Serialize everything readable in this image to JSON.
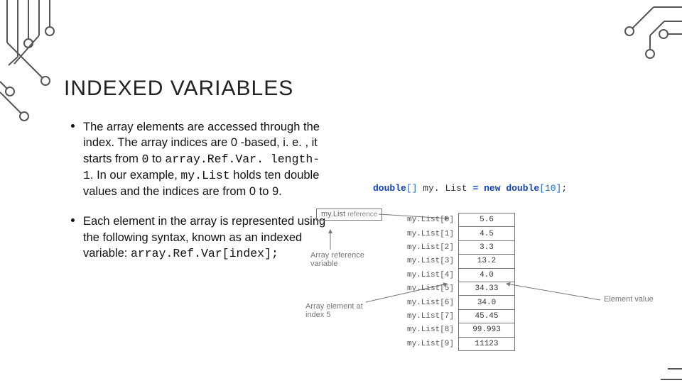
{
  "title": "INDEXED VARIABLES",
  "bullets": {
    "b1": {
      "pre": "The array elements are accessed through the index. The array indices are 0 -based, i. e. , it starts from ",
      "zero": "0",
      "mid1": " to ",
      "code1": "array.Ref.Var. length-1",
      "mid2": ". In our example, ",
      "code2": "my.List",
      "post": " holds ten double values and the indices are from 0 to 9."
    },
    "b2": {
      "pre": "Each element in the array is represented using the following syntax, known as an indexed variable: ",
      "code": "array.Ref.Var[index];"
    }
  },
  "decl": {
    "type_kw": "double",
    "brackets": "[]",
    "var": "my. List",
    "eq": "=",
    "new_kw": "new",
    "type_kw2": "double",
    "ob": "[",
    "size": "10",
    "cb": "]",
    "semi": ";"
  },
  "refbox": {
    "line1": "my.List",
    "line2": "reference"
  },
  "labels": {
    "array_ref_var": "Array reference\nvariable",
    "array_elem_at": "Array element at\nindex 5",
    "elem_value": "Element value"
  },
  "array": {
    "name": "my.List",
    "rows": [
      {
        "i": "[0]",
        "v": "5.6"
      },
      {
        "i": "[1]",
        "v": "4.5"
      },
      {
        "i": "[2]",
        "v": "3.3"
      },
      {
        "i": "[3]",
        "v": "13.2"
      },
      {
        "i": "[4]",
        "v": "4.0"
      },
      {
        "i": "[5]",
        "v": "34.33"
      },
      {
        "i": "[6]",
        "v": "34.0"
      },
      {
        "i": "[7]",
        "v": "45.45"
      },
      {
        "i": "[8]",
        "v": "99.993"
      },
      {
        "i": "[9]",
        "v": "11123"
      }
    ]
  }
}
